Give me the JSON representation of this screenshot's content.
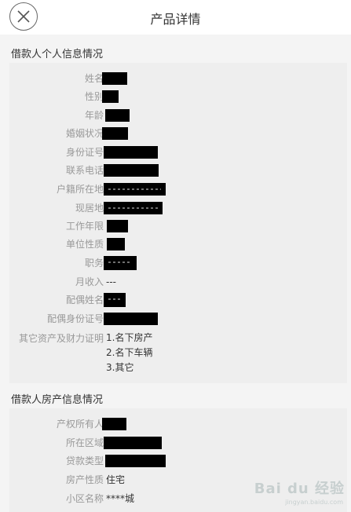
{
  "header": {
    "title": "产品详情"
  },
  "borrower_section": {
    "title": "借款人个人信息情况",
    "fields": [
      {
        "label": "姓名"
      },
      {
        "label": "性别"
      },
      {
        "label": "年龄"
      },
      {
        "label": "婚姻状况"
      },
      {
        "label": "身份证号"
      },
      {
        "label": "联系电话"
      },
      {
        "label": "户籍所在地"
      },
      {
        "label": "现居地"
      },
      {
        "label": "工作年限"
      },
      {
        "label": "单位性质"
      },
      {
        "label": "职务"
      },
      {
        "label": "月收入",
        "value": "---"
      },
      {
        "label": "配偶姓名"
      },
      {
        "label": "配偶身份证号"
      }
    ],
    "assets": {
      "label": "其它资产及财力证明",
      "lines": [
        "1.名下房产",
        "2.名下车辆",
        "3.其它"
      ]
    }
  },
  "property_section": {
    "title": "借款人房产信息情况",
    "fields": [
      {
        "label": "产权所有人"
      },
      {
        "label": "所在区域"
      },
      {
        "label": "贷款类型"
      },
      {
        "label": "房产性质",
        "value": "住宅"
      },
      {
        "label": "小区名称",
        "value": "****城"
      }
    ]
  },
  "watermark": {
    "text": "Bai du 经验",
    "sub": "jingyan.baidu.com"
  }
}
